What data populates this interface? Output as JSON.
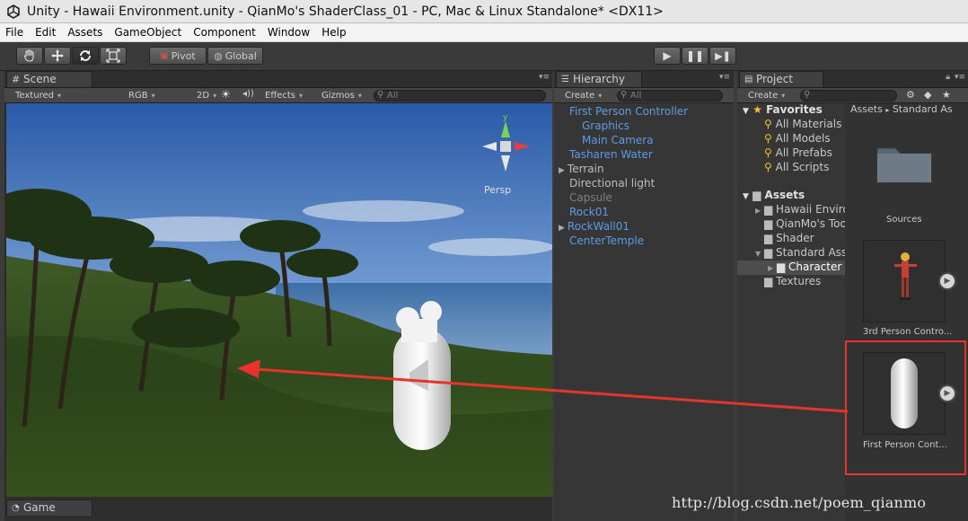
{
  "window": {
    "title": "Unity - Hawaii Environment.unity - QianMo's ShaderClass_01 - PC, Mac & Linux Standalone* <DX11>"
  },
  "menu": [
    "File",
    "Edit",
    "Assets",
    "GameObject",
    "Component",
    "Window",
    "Help"
  ],
  "toolbar": {
    "pivot_label": "Pivot",
    "global_label": "Global"
  },
  "scene": {
    "tab_label": "Scene",
    "shading_mode": "Textured",
    "render_mode": "RGB",
    "mode_2d": "2D",
    "effects_label": "Effects",
    "gizmos_label": "Gizmos",
    "search_placeholder": "All",
    "gizmo_axis_y": "y",
    "persp_label": "Persp"
  },
  "game": {
    "tab_label": "Game"
  },
  "hierarchy": {
    "tab_label": "Hierarchy",
    "create_label": "Create",
    "search_placeholder": "All",
    "items": [
      {
        "label": "First Person Controller",
        "style": "blue",
        "indent": 0,
        "arrow": "▼"
      },
      {
        "label": "Graphics",
        "style": "blue",
        "indent": 1,
        "arrow": ""
      },
      {
        "label": "Main Camera",
        "style": "blue",
        "indent": 1,
        "arrow": ""
      },
      {
        "label": "Tasharen Water",
        "style": "blue",
        "indent": 0,
        "arrow": ""
      },
      {
        "label": "Terrain",
        "style": "grey",
        "indent": 0,
        "arrow": "▶"
      },
      {
        "label": "Directional light",
        "style": "grey",
        "indent": 0,
        "arrow": ""
      },
      {
        "label": "Capsule",
        "style": "dim",
        "indent": 0,
        "arrow": ""
      },
      {
        "label": "Rock01",
        "style": "blue",
        "indent": 0,
        "arrow": ""
      },
      {
        "label": "RockWall01",
        "style": "blue",
        "indent": 0,
        "arrow": "▶"
      },
      {
        "label": "CenterTemple",
        "style": "blue",
        "indent": 0,
        "arrow": ""
      }
    ]
  },
  "project": {
    "tab_label": "Project",
    "create_label": "Create",
    "favorites_label": "Favorites",
    "favorites": [
      "All Materials",
      "All Models",
      "All Prefabs",
      "All Scripts"
    ],
    "assets_label": "Assets",
    "folders": [
      "Hawaii Enviro",
      "QianMo's Too",
      "Shader",
      "Standard Ass",
      "Character",
      "Textures"
    ],
    "breadcrumb": [
      "Assets",
      "Standard As"
    ],
    "thumbnails": [
      {
        "label": "Sources"
      },
      {
        "label": "3rd Person Contro..."
      },
      {
        "label": "First Person Cont..."
      }
    ]
  },
  "annotation": {
    "highlight_color": "#e8322c",
    "watermark": "http://blog.csdn.net/poem_qianmo"
  }
}
